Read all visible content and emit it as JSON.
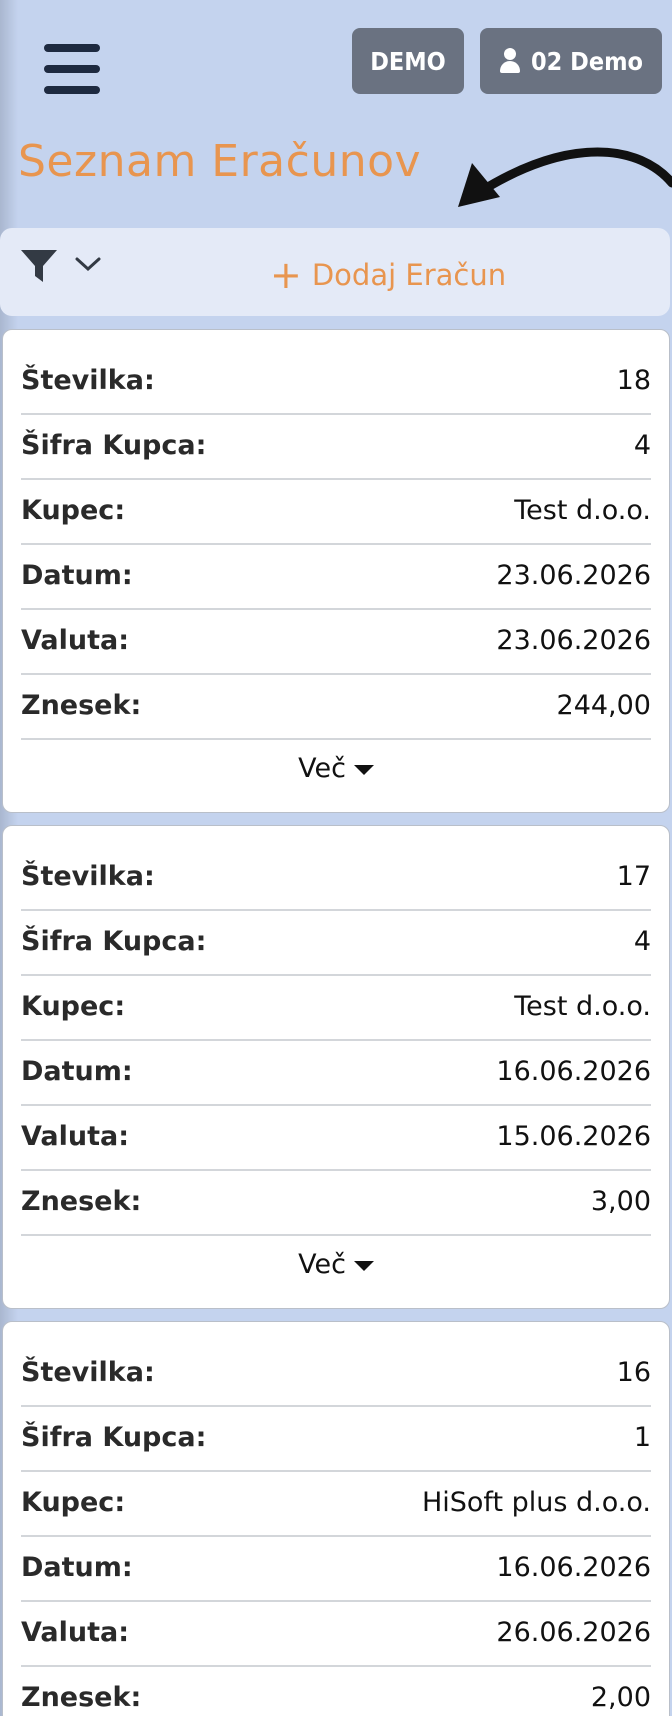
{
  "header": {
    "demo_label": "DEMO",
    "user_label": "02 Demo"
  },
  "page": {
    "title": "Seznam Eračunov",
    "add_label": "Dodaj Eračun"
  },
  "labels": {
    "stevilka": "Številka:",
    "sifra": "Šifra Kupca:",
    "kupec": "Kupec:",
    "datum": "Datum:",
    "valuta": "Valuta:",
    "znesek": "Znesek:",
    "more": "Več"
  },
  "invoices": [
    {
      "stevilka": "18",
      "sifra": "4",
      "kupec": "Test d.o.o.",
      "datum": "23.06.2026",
      "valuta": "23.06.2026",
      "znesek": "244,00"
    },
    {
      "stevilka": "17",
      "sifra": "4",
      "kupec": "Test d.o.o.",
      "datum": "16.06.2026",
      "valuta": "15.06.2026",
      "znesek": "3,00"
    },
    {
      "stevilka": "16",
      "sifra": "1",
      "kupec": "HiSoft plus d.o.o.",
      "datum": "16.06.2026",
      "valuta": "26.06.2026",
      "znesek": "2,00"
    }
  ],
  "icons": {
    "menu": "hamburger-menu-icon",
    "user": "user-icon",
    "filter": "filter-icon",
    "chevron": "chevron-down-icon",
    "caret": "caret-down-icon",
    "arrow": "curved-arrow-icon"
  },
  "colors": {
    "accent": "#e8954f",
    "background": "#c4d3ee",
    "button": "#6a7281"
  }
}
